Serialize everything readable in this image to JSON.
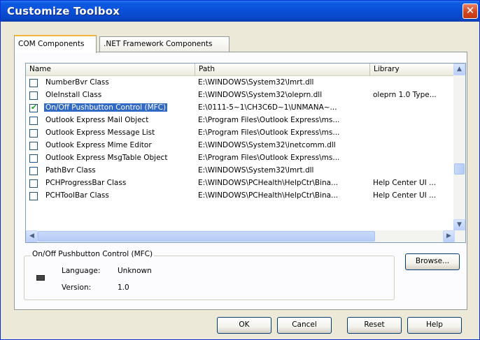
{
  "window": {
    "title": "Customize Toolbox",
    "close_glyph": "✕"
  },
  "tabs": [
    {
      "label": "COM Components",
      "active": true
    },
    {
      "label": ".NET Framework Components",
      "active": false
    }
  ],
  "columns": {
    "name": "Name",
    "path": "Path",
    "library": "Library"
  },
  "rows": [
    {
      "name": "NumberBvr Class",
      "path": "E:\\WINDOWS\\System32\\lmrt.dll",
      "library": "",
      "checked": false,
      "selected": false
    },
    {
      "name": "OleInstall Class",
      "path": "E:\\WINDOWS\\System32\\oleprn.dll",
      "library": "oleprn 1.0 Type...",
      "checked": false,
      "selected": false
    },
    {
      "name": "On/Off Pushbutton Control (MFC)",
      "path": "E:\\0111-5~1\\CH3C6D~1\\UNMANA~...",
      "library": "",
      "checked": true,
      "selected": true
    },
    {
      "name": "Outlook Express Mail Object",
      "path": "E:\\Program Files\\Outlook Express\\ms...",
      "library": "",
      "checked": false,
      "selected": false
    },
    {
      "name": "Outlook Express Message List",
      "path": "E:\\Program Files\\Outlook Express\\ms...",
      "library": "",
      "checked": false,
      "selected": false
    },
    {
      "name": "Outlook Express Mime Editor",
      "path": "E:\\WINDOWS\\System32\\inetcomm.dll",
      "library": "",
      "checked": false,
      "selected": false
    },
    {
      "name": "Outlook Express MsgTable Object",
      "path": "E:\\Program Files\\Outlook Express\\ms...",
      "library": "",
      "checked": false,
      "selected": false
    },
    {
      "name": "PathBvr Class",
      "path": "E:\\WINDOWS\\System32\\lmrt.dll",
      "library": "",
      "checked": false,
      "selected": false
    },
    {
      "name": "PCHProgressBar Class",
      "path": "E:\\WINDOWS\\PCHealth\\HelpCtr\\Bina...",
      "library": "Help Center UI ...",
      "checked": false,
      "selected": false
    },
    {
      "name": "PCHToolBar Class",
      "path": "E:\\WINDOWS\\PCHealth\\HelpCtr\\Bina...",
      "library": "Help Center UI ...",
      "checked": false,
      "selected": false
    }
  ],
  "details": {
    "group_title": "On/Off Pushbutton Control (MFC)",
    "language_label": "Language:",
    "language_value": "Unknown",
    "version_label": "Version:",
    "version_value": "1.0",
    "browse_label": "Browse..."
  },
  "buttons": {
    "ok": "OK",
    "cancel": "Cancel",
    "reset": "Reset",
    "help": "Help"
  },
  "icons": {
    "scroll_up": "▲",
    "scroll_down": "▼",
    "scroll_left": "◀",
    "scroll_right": "▶"
  },
  "colors": {
    "title_bar": "#0a4fd6",
    "selection": "#316ac5",
    "tab_highlight": "#f5b43c"
  }
}
